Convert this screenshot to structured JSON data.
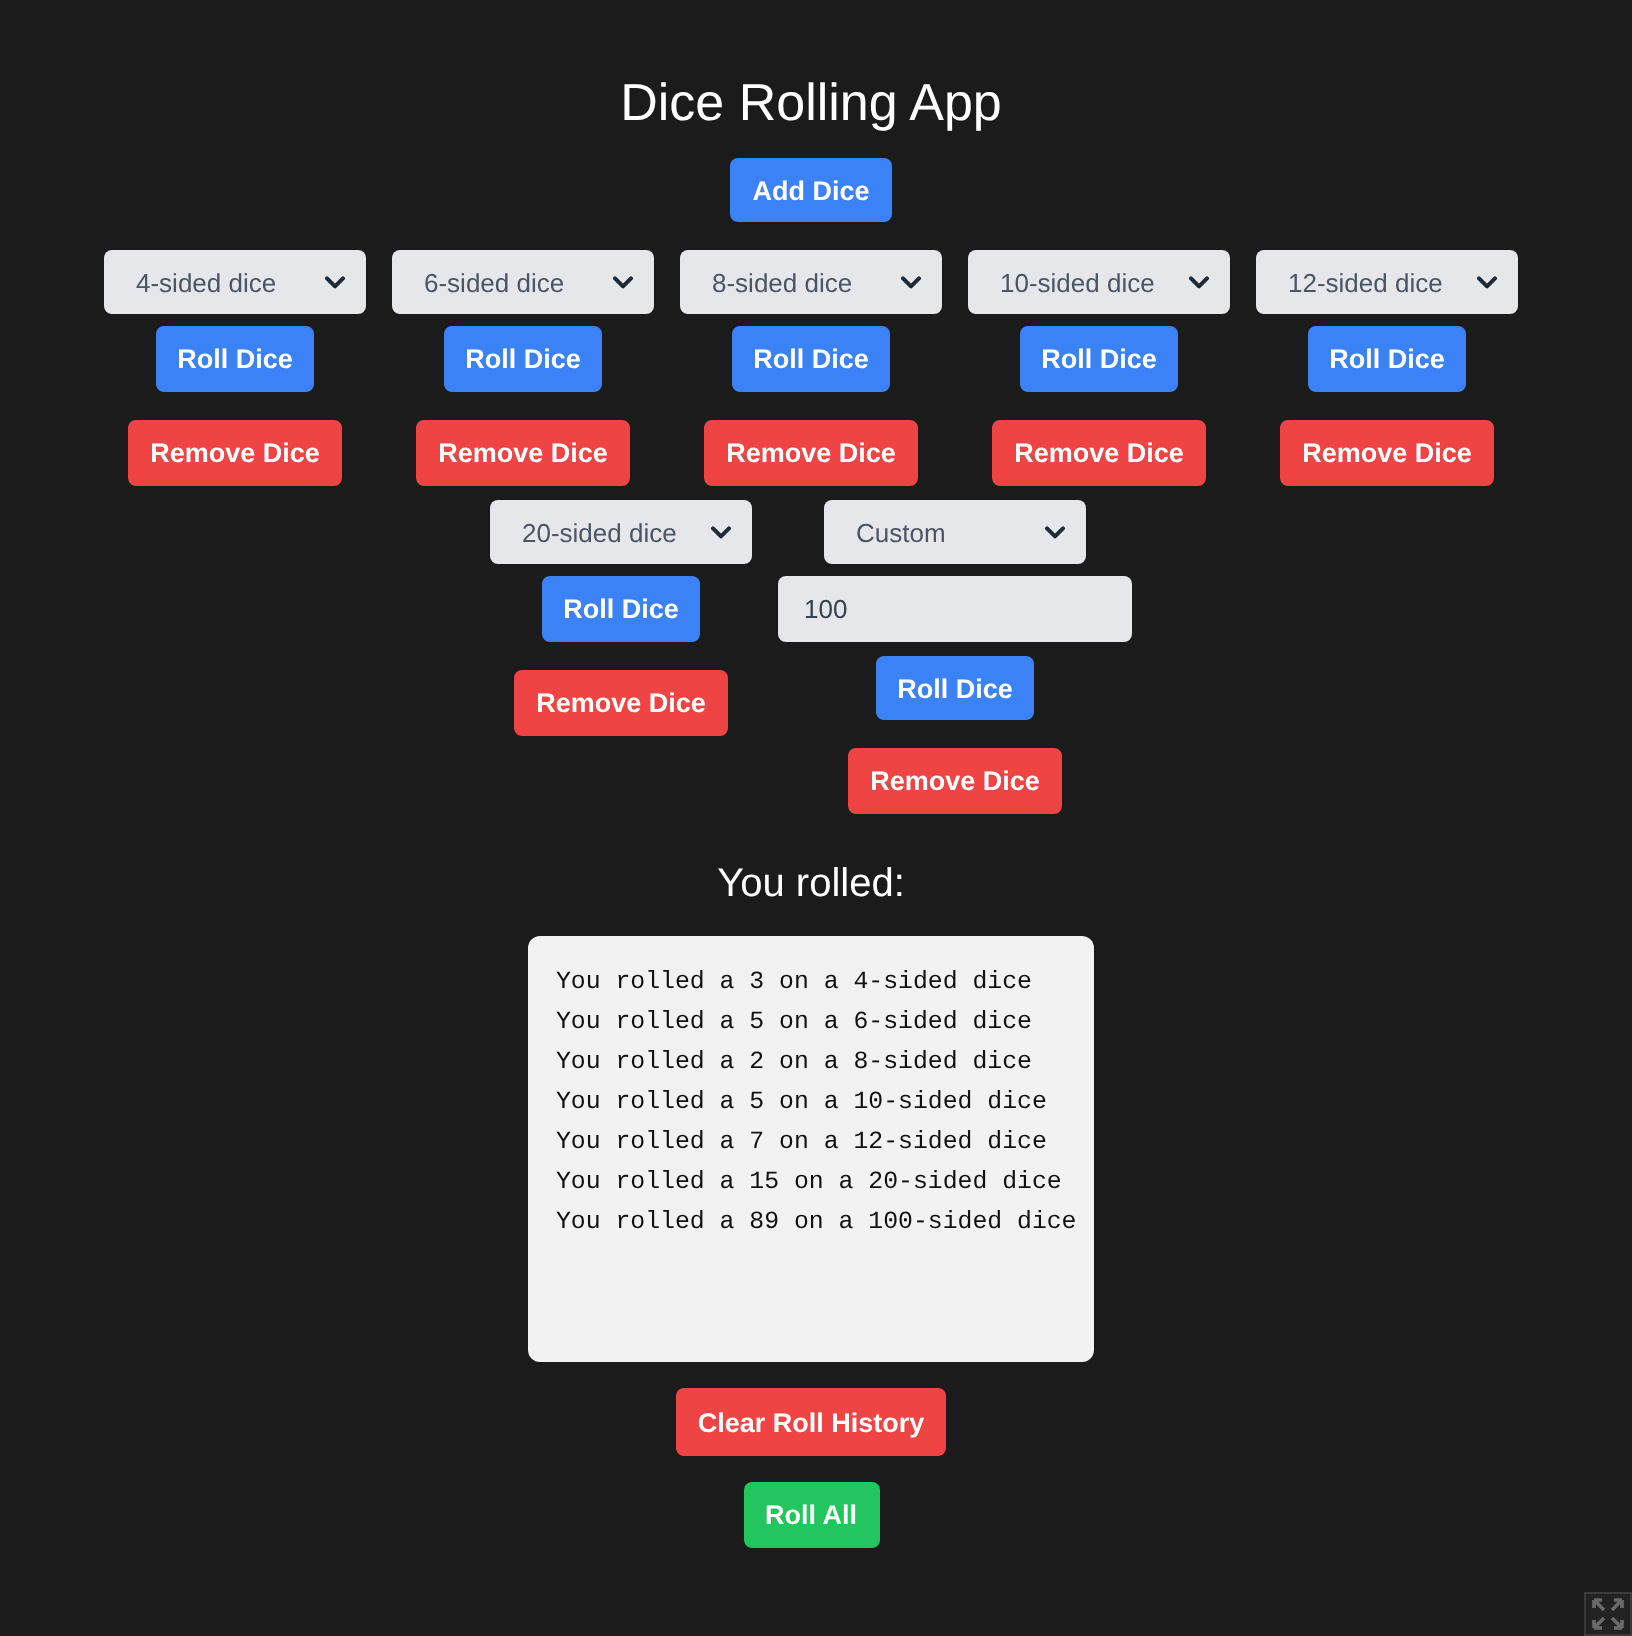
{
  "title": "Dice Rolling App",
  "add_button": "Add Dice",
  "dice": [
    {
      "kind": "preset",
      "selected_option": "4-sided dice",
      "roll_button": "Roll Dice",
      "remove_button": "Remove Dice"
    },
    {
      "kind": "preset",
      "selected_option": "6-sided dice",
      "roll_button": "Roll Dice",
      "remove_button": "Remove Dice"
    },
    {
      "kind": "preset",
      "selected_option": "8-sided dice",
      "roll_button": "Roll Dice",
      "remove_button": "Remove Dice"
    },
    {
      "kind": "preset",
      "selected_option": "10-sided dice",
      "roll_button": "Roll Dice",
      "remove_button": "Remove Dice"
    },
    {
      "kind": "preset",
      "selected_option": "12-sided dice",
      "roll_button": "Roll Dice",
      "remove_button": "Remove Dice"
    },
    {
      "kind": "preset",
      "selected_option": "20-sided dice",
      "roll_button": "Roll Dice",
      "remove_button": "Remove Dice"
    },
    {
      "kind": "custom",
      "selected_option": "Custom",
      "custom_sides": "100",
      "roll_button": "Roll Dice",
      "remove_button": "Remove Dice"
    }
  ],
  "results": {
    "heading": "You rolled:",
    "lines": [
      "You rolled a 3 on a 4-sided dice",
      "You rolled a 5 on a 6-sided dice",
      "You rolled a 2 on a 8-sided dice",
      "You rolled a 5 on a 10-sided dice",
      "You rolled a 7 on a 12-sided dice",
      "You rolled a 15 on a 20-sided dice",
      "You rolled a 89 on a 100-sided dice"
    ]
  },
  "clear_button": "Clear Roll History",
  "roll_all_button": "Roll All"
}
